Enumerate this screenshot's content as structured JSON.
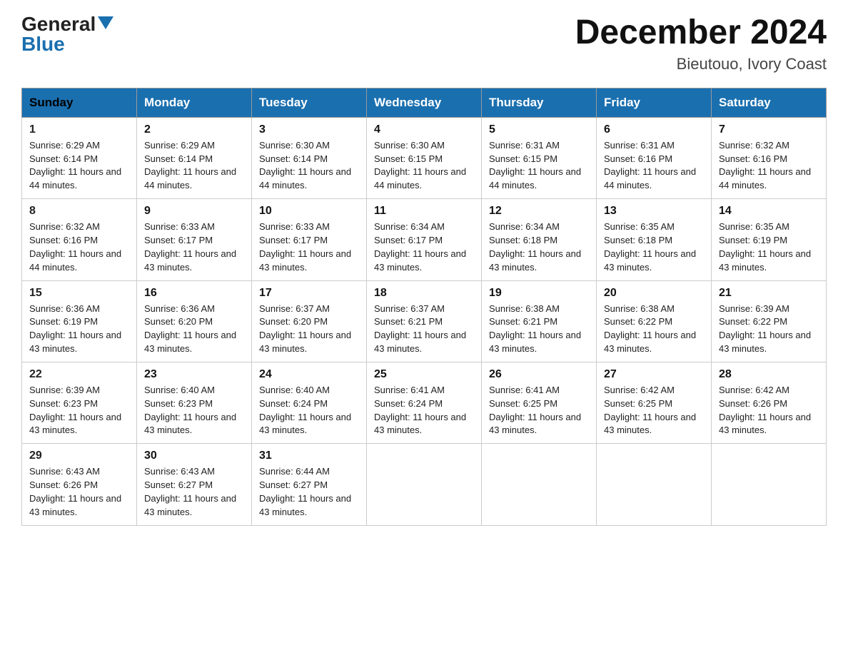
{
  "header": {
    "logo_general": "General",
    "logo_blue": "Blue",
    "month_title": "December 2024",
    "location": "Bieutouo, Ivory Coast"
  },
  "weekdays": [
    "Sunday",
    "Monday",
    "Tuesday",
    "Wednesday",
    "Thursday",
    "Friday",
    "Saturday"
  ],
  "weeks": [
    [
      {
        "day": "1",
        "sunrise": "6:29 AM",
        "sunset": "6:14 PM",
        "daylight": "11 hours and 44 minutes."
      },
      {
        "day": "2",
        "sunrise": "6:29 AM",
        "sunset": "6:14 PM",
        "daylight": "11 hours and 44 minutes."
      },
      {
        "day": "3",
        "sunrise": "6:30 AM",
        "sunset": "6:14 PM",
        "daylight": "11 hours and 44 minutes."
      },
      {
        "day": "4",
        "sunrise": "6:30 AM",
        "sunset": "6:15 PM",
        "daylight": "11 hours and 44 minutes."
      },
      {
        "day": "5",
        "sunrise": "6:31 AM",
        "sunset": "6:15 PM",
        "daylight": "11 hours and 44 minutes."
      },
      {
        "day": "6",
        "sunrise": "6:31 AM",
        "sunset": "6:16 PM",
        "daylight": "11 hours and 44 minutes."
      },
      {
        "day": "7",
        "sunrise": "6:32 AM",
        "sunset": "6:16 PM",
        "daylight": "11 hours and 44 minutes."
      }
    ],
    [
      {
        "day": "8",
        "sunrise": "6:32 AM",
        "sunset": "6:16 PM",
        "daylight": "11 hours and 44 minutes."
      },
      {
        "day": "9",
        "sunrise": "6:33 AM",
        "sunset": "6:17 PM",
        "daylight": "11 hours and 43 minutes."
      },
      {
        "day": "10",
        "sunrise": "6:33 AM",
        "sunset": "6:17 PM",
        "daylight": "11 hours and 43 minutes."
      },
      {
        "day": "11",
        "sunrise": "6:34 AM",
        "sunset": "6:17 PM",
        "daylight": "11 hours and 43 minutes."
      },
      {
        "day": "12",
        "sunrise": "6:34 AM",
        "sunset": "6:18 PM",
        "daylight": "11 hours and 43 minutes."
      },
      {
        "day": "13",
        "sunrise": "6:35 AM",
        "sunset": "6:18 PM",
        "daylight": "11 hours and 43 minutes."
      },
      {
        "day": "14",
        "sunrise": "6:35 AM",
        "sunset": "6:19 PM",
        "daylight": "11 hours and 43 minutes."
      }
    ],
    [
      {
        "day": "15",
        "sunrise": "6:36 AM",
        "sunset": "6:19 PM",
        "daylight": "11 hours and 43 minutes."
      },
      {
        "day": "16",
        "sunrise": "6:36 AM",
        "sunset": "6:20 PM",
        "daylight": "11 hours and 43 minutes."
      },
      {
        "day": "17",
        "sunrise": "6:37 AM",
        "sunset": "6:20 PM",
        "daylight": "11 hours and 43 minutes."
      },
      {
        "day": "18",
        "sunrise": "6:37 AM",
        "sunset": "6:21 PM",
        "daylight": "11 hours and 43 minutes."
      },
      {
        "day": "19",
        "sunrise": "6:38 AM",
        "sunset": "6:21 PM",
        "daylight": "11 hours and 43 minutes."
      },
      {
        "day": "20",
        "sunrise": "6:38 AM",
        "sunset": "6:22 PM",
        "daylight": "11 hours and 43 minutes."
      },
      {
        "day": "21",
        "sunrise": "6:39 AM",
        "sunset": "6:22 PM",
        "daylight": "11 hours and 43 minutes."
      }
    ],
    [
      {
        "day": "22",
        "sunrise": "6:39 AM",
        "sunset": "6:23 PM",
        "daylight": "11 hours and 43 minutes."
      },
      {
        "day": "23",
        "sunrise": "6:40 AM",
        "sunset": "6:23 PM",
        "daylight": "11 hours and 43 minutes."
      },
      {
        "day": "24",
        "sunrise": "6:40 AM",
        "sunset": "6:24 PM",
        "daylight": "11 hours and 43 minutes."
      },
      {
        "day": "25",
        "sunrise": "6:41 AM",
        "sunset": "6:24 PM",
        "daylight": "11 hours and 43 minutes."
      },
      {
        "day": "26",
        "sunrise": "6:41 AM",
        "sunset": "6:25 PM",
        "daylight": "11 hours and 43 minutes."
      },
      {
        "day": "27",
        "sunrise": "6:42 AM",
        "sunset": "6:25 PM",
        "daylight": "11 hours and 43 minutes."
      },
      {
        "day": "28",
        "sunrise": "6:42 AM",
        "sunset": "6:26 PM",
        "daylight": "11 hours and 43 minutes."
      }
    ],
    [
      {
        "day": "29",
        "sunrise": "6:43 AM",
        "sunset": "6:26 PM",
        "daylight": "11 hours and 43 minutes."
      },
      {
        "day": "30",
        "sunrise": "6:43 AM",
        "sunset": "6:27 PM",
        "daylight": "11 hours and 43 minutes."
      },
      {
        "day": "31",
        "sunrise": "6:44 AM",
        "sunset": "6:27 PM",
        "daylight": "11 hours and 43 minutes."
      },
      null,
      null,
      null,
      null
    ]
  ]
}
